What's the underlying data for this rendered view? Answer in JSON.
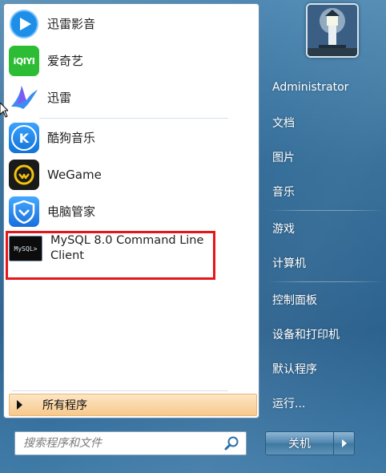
{
  "pinned_programs": [
    {
      "label": "迅雷影音",
      "icon": "xunlei-video-icon"
    },
    {
      "label": "爱奇艺",
      "icon": "iqiyi-icon",
      "icon_text": "iQIYI"
    },
    {
      "label": "迅雷",
      "icon": "xunlei-bird-icon"
    }
  ],
  "recent_programs": [
    {
      "label": "酷狗音乐",
      "icon": "kugou-icon",
      "icon_text": "K"
    },
    {
      "label": "WeGame",
      "icon": "wegame-icon"
    },
    {
      "label": "电脑管家",
      "icon": "tencent-pc-manager-icon"
    },
    {
      "label": "MySQL 8.0 Command Line Client",
      "icon": "mysql-console-icon",
      "icon_text": "MySQL>"
    }
  ],
  "all_programs": {
    "label": "所有程序"
  },
  "search": {
    "placeholder": "搜索程序和文件"
  },
  "right_menu": [
    {
      "label": "Administrator"
    },
    {
      "label": "文档"
    },
    {
      "label": "图片"
    },
    {
      "label": "音乐"
    },
    {
      "label": "游戏"
    },
    {
      "label": "计算机"
    },
    {
      "label": "控制面板"
    },
    {
      "label": "设备和打印机"
    },
    {
      "label": "默认程序"
    },
    {
      "label": "运行..."
    }
  ],
  "shutdown": {
    "label": "关机"
  },
  "colors": {
    "highlight_border": "#e5161b",
    "all_programs_bg": "#f7c98d",
    "frame_blue": "#2f6a96"
  }
}
